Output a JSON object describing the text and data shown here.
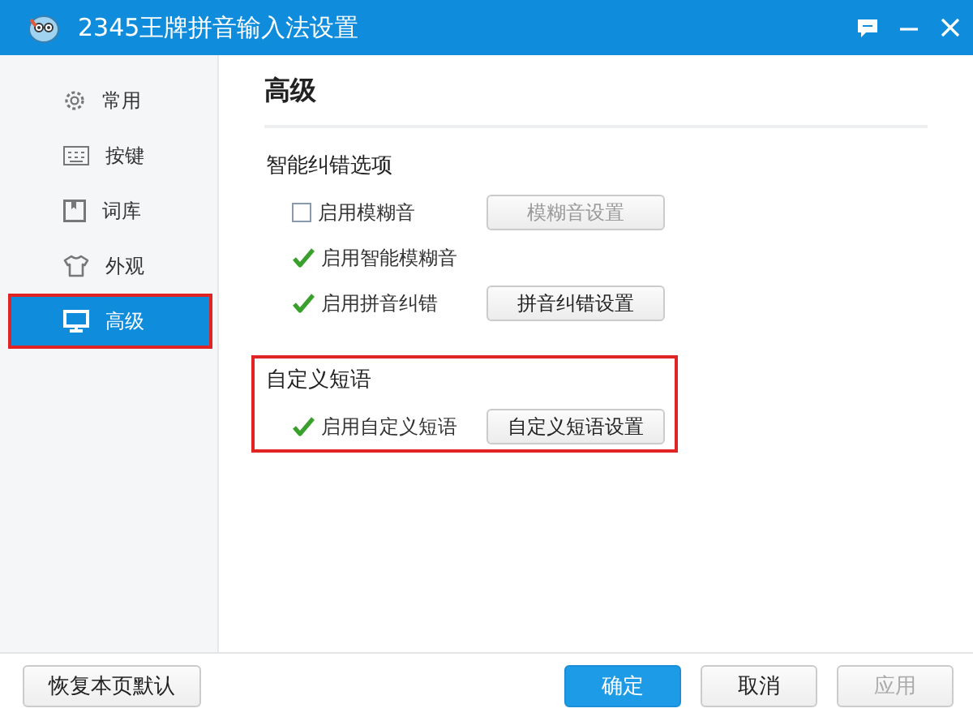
{
  "window": {
    "title": "2345王牌拼音输入法设置"
  },
  "sidebar": {
    "items": [
      {
        "label": "常用",
        "kind": "gear",
        "selected": false,
        "highlighted": false
      },
      {
        "label": "按键",
        "kind": "keyboard",
        "selected": false,
        "highlighted": false
      },
      {
        "label": "词库",
        "kind": "book",
        "selected": false,
        "highlighted": false
      },
      {
        "label": "外观",
        "kind": "shirt",
        "selected": false,
        "highlighted": false
      },
      {
        "label": "高级",
        "kind": "monitor",
        "selected": true,
        "highlighted": true
      }
    ]
  },
  "panel": {
    "title": "高级",
    "sections": [
      {
        "title": "智能纠错选项",
        "highlighted": false,
        "options": [
          {
            "label": "启用模糊音",
            "checked": false,
            "button": {
              "label": "模糊音设置",
              "disabled": true
            }
          },
          {
            "label": "启用智能模糊音",
            "checked": true
          },
          {
            "label": "启用拼音纠错",
            "checked": true,
            "button": {
              "label": "拼音纠错设置",
              "disabled": false
            }
          }
        ]
      },
      {
        "title": "自定义短语",
        "highlighted": true,
        "options": [
          {
            "label": "启用自定义短语",
            "checked": true,
            "button": {
              "label": "自定义短语设置",
              "disabled": false
            }
          }
        ]
      }
    ]
  },
  "footer": {
    "reset": "恢复本页默认",
    "buttons": [
      {
        "label": "确定",
        "kind": "primary",
        "disabled": false
      },
      {
        "label": "取消",
        "kind": "normal",
        "disabled": false
      },
      {
        "label": "应用",
        "kind": "normal",
        "disabled": true
      }
    ]
  }
}
